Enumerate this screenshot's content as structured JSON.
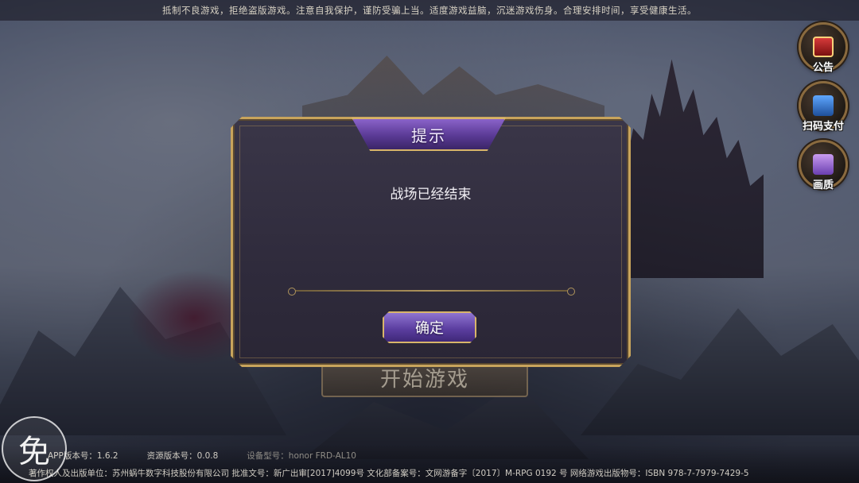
{
  "notice": {
    "text": "抵制不良游戏，拒绝盗版游戏。注意自我保护，谨防受骗上当。适度游戏益脑，沉迷游戏伤身。合理安排时间，享受健康生活。"
  },
  "side_buttons": [
    {
      "label": "公告",
      "icon": "announcement-icon"
    },
    {
      "label": "扫码支付",
      "icon": "scan-pay-icon"
    },
    {
      "label": "画质",
      "icon": "graphics-quality-icon"
    }
  ],
  "start_button": {
    "label": "开始游戏"
  },
  "dialog": {
    "title": "提示",
    "message": "战场已经结束",
    "confirm_label": "确定"
  },
  "footer": {
    "app_version": "APP版本号：1.6.2",
    "resource_version": "资源版本号：0.0.8",
    "device_model": "设备型号：honor FRD-AL10",
    "publisher_line": "著作权人及出版单位：苏州蜗牛数字科技股份有限公司  批准文号：新广出审[2017]4099号  文化部备案号：文网游备字〔2017〕M-RPG 0192 号  网络游戏出版物号：ISBN 978-7-7979-7429-5"
  },
  "badge": {
    "label": "免"
  },
  "colors": {
    "gold_border": "#c8a45c",
    "purple_button": "#5c3fa1",
    "dialog_bg": "#2f2b3c"
  }
}
